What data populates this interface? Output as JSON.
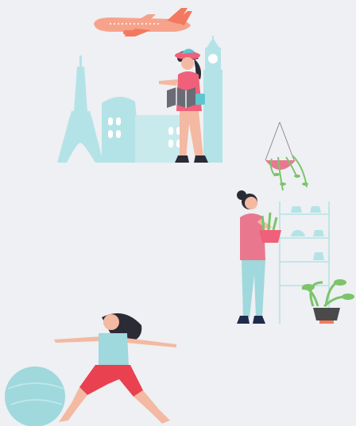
{
  "page": {
    "background": "#eef0f3"
  },
  "palette": {
    "teal_light": "#b4e3e7",
    "teal": "#9fd8dd",
    "coral": "#f0607a",
    "salmon": "#f59b83",
    "pink_shirt": "#e9788f",
    "skin": "#f4b9a2",
    "hair": "#2b2b35",
    "pot_dark": "#4a4a4a",
    "plant_green": "#7cc46b",
    "shorts_red": "#e9414f",
    "ball": "#9fd8dd"
  },
  "illustrations": [
    {
      "name": "travel",
      "elements": [
        "airplane",
        "eiffel-tower",
        "colosseum",
        "big-ben",
        "tourist-woman",
        "map"
      ]
    },
    {
      "name": "gardening",
      "elements": [
        "hanging-planter",
        "plant-shelf",
        "potted-plant",
        "woman-holding-plant"
      ]
    },
    {
      "name": "fitness",
      "elements": [
        "yoga-woman",
        "exercise-ball"
      ]
    }
  ]
}
